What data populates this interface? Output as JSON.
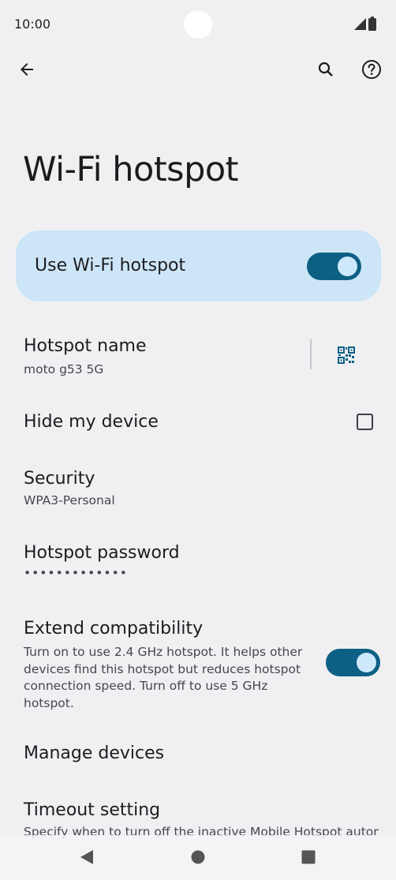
{
  "status_bar": {
    "time": "10:00"
  },
  "app_bar": {
    "icons": [
      "back-arrow-icon",
      "search-icon",
      "help-icon"
    ]
  },
  "page": {
    "title": "Wi-Fi hotspot"
  },
  "main_switch": {
    "label": "Use Wi-Fi hotspot",
    "on": true
  },
  "settings": {
    "hotspot_name": {
      "title": "Hotspot name",
      "value": "moto g53 5G",
      "icon": "qr-code-icon"
    },
    "hide_device": {
      "title": "Hide my device",
      "checked": false
    },
    "security": {
      "title": "Security",
      "value": "WPA3-Personal"
    },
    "password": {
      "title": "Hotspot password",
      "value": "•••••••••••••"
    },
    "extend": {
      "title": "Extend compatibility",
      "summary": "Turn on to use 2.4 GHz hotspot. It helps other devices find this hotspot but reduces hotspot connection speed. Turn off to use 5 GHz hotspot.",
      "on": true
    },
    "manage": {
      "title": "Manage devices"
    },
    "timeout": {
      "title": "Timeout setting",
      "summary": "Specify when to turn off the inactive Mobile Hotspot automatically"
    }
  },
  "colors": {
    "background": "#f0f0f3",
    "card": "#cce5f7",
    "toggle_track": "#0d5f84",
    "toggle_knob": "#cde8fb",
    "qr_icon": "#0d5f84"
  },
  "nav_bar": {
    "icons": [
      "nav-back-icon",
      "nav-home-icon",
      "nav-recents-icon"
    ]
  }
}
